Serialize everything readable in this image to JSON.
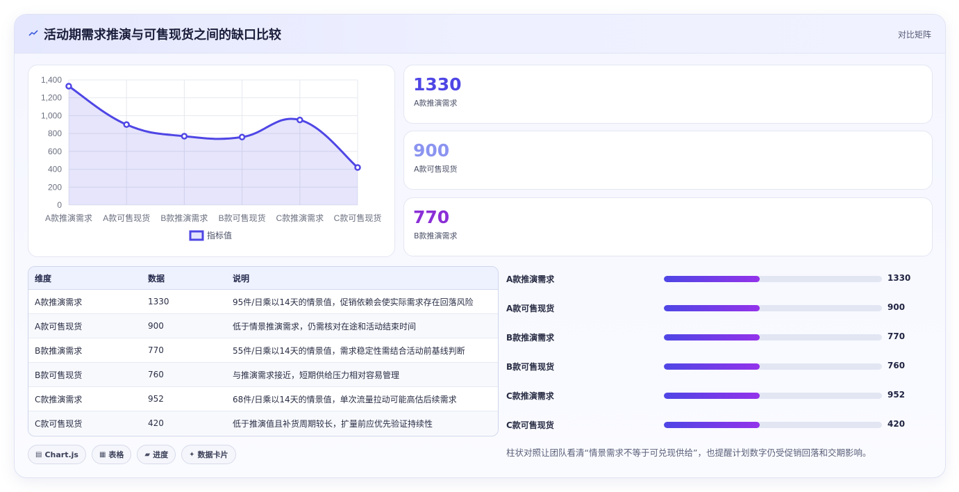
{
  "header": {
    "title": "活动期需求推演与可售现货之间的缺口比较",
    "link": "对比矩阵"
  },
  "kpis": [
    {
      "value": "1330",
      "label": "A款推演需求",
      "color": "#4f46e5"
    },
    {
      "value": "900",
      "label": "A款可售现货",
      "color": "#8b94f0"
    },
    {
      "value": "770",
      "label": "B款推演需求",
      "color": "#8b2fd6"
    }
  ],
  "table": {
    "headers": [
      "维度",
      "数据",
      "说明"
    ],
    "rows": [
      [
        "A款推演需求",
        "1330",
        "95件/日乘以14天的情景值，促销依赖会使实际需求存在回落风险"
      ],
      [
        "A款可售现货",
        "900",
        "低于情景推演需求，仍需核对在途和活动结束时间"
      ],
      [
        "B款推演需求",
        "770",
        "55件/日乘以14天的情景值，需求稳定性需结合活动前基线判断"
      ],
      [
        "B款可售现货",
        "760",
        "与推演需求接近，短期供给压力相对容易管理"
      ],
      [
        "C款推演需求",
        "952",
        "68件/日乘以14天的情景值，单次流量拉动可能高估后续需求"
      ],
      [
        "C款可售现货",
        "420",
        "低于推演值且补货周期较长，扩量前应优先验证持续性"
      ]
    ]
  },
  "progress": {
    "items": [
      {
        "label": "A款推演需求",
        "value": "1330",
        "fill": 0.44
      },
      {
        "label": "A款可售现货",
        "value": "900",
        "fill": 0.44
      },
      {
        "label": "B款推演需求",
        "value": "770",
        "fill": 0.44
      },
      {
        "label": "B款可售现货",
        "value": "760",
        "fill": 0.44
      },
      {
        "label": "C款推演需求",
        "value": "952",
        "fill": 0.44
      },
      {
        "label": "C款可售现货",
        "value": "420",
        "fill": 0.44
      }
    ]
  },
  "note": "柱状对照让团队看清“情景需求不等于可兑现供给”，也提醒计划数字仍受促销回落和交期影响。",
  "chips": [
    {
      "icon": "chart-icon",
      "glyph": "▤",
      "label": "Chart.js"
    },
    {
      "icon": "table-icon",
      "glyph": "▦",
      "label": "表格"
    },
    {
      "icon": "progress-icon",
      "glyph": "▰",
      "label": "进度"
    },
    {
      "icon": "sparkle-icon",
      "glyph": "✦",
      "label": "数据卡片"
    }
  ],
  "chart_data": {
    "type": "area",
    "categories": [
      "A款推演需求",
      "A款可售现货",
      "B款推演需求",
      "B款可售现货",
      "C款推演需求",
      "C款可售现货"
    ],
    "series": [
      {
        "name": "指标值",
        "values": [
          1330,
          900,
          770,
          760,
          952,
          420
        ]
      }
    ],
    "ylim": [
      0,
      1400
    ],
    "yticks": [
      "0",
      "200",
      "400",
      "600",
      "800",
      "1,000",
      "1,200",
      "1,400"
    ],
    "legend": "bottom",
    "grid": true,
    "color": "#4f46e5"
  }
}
